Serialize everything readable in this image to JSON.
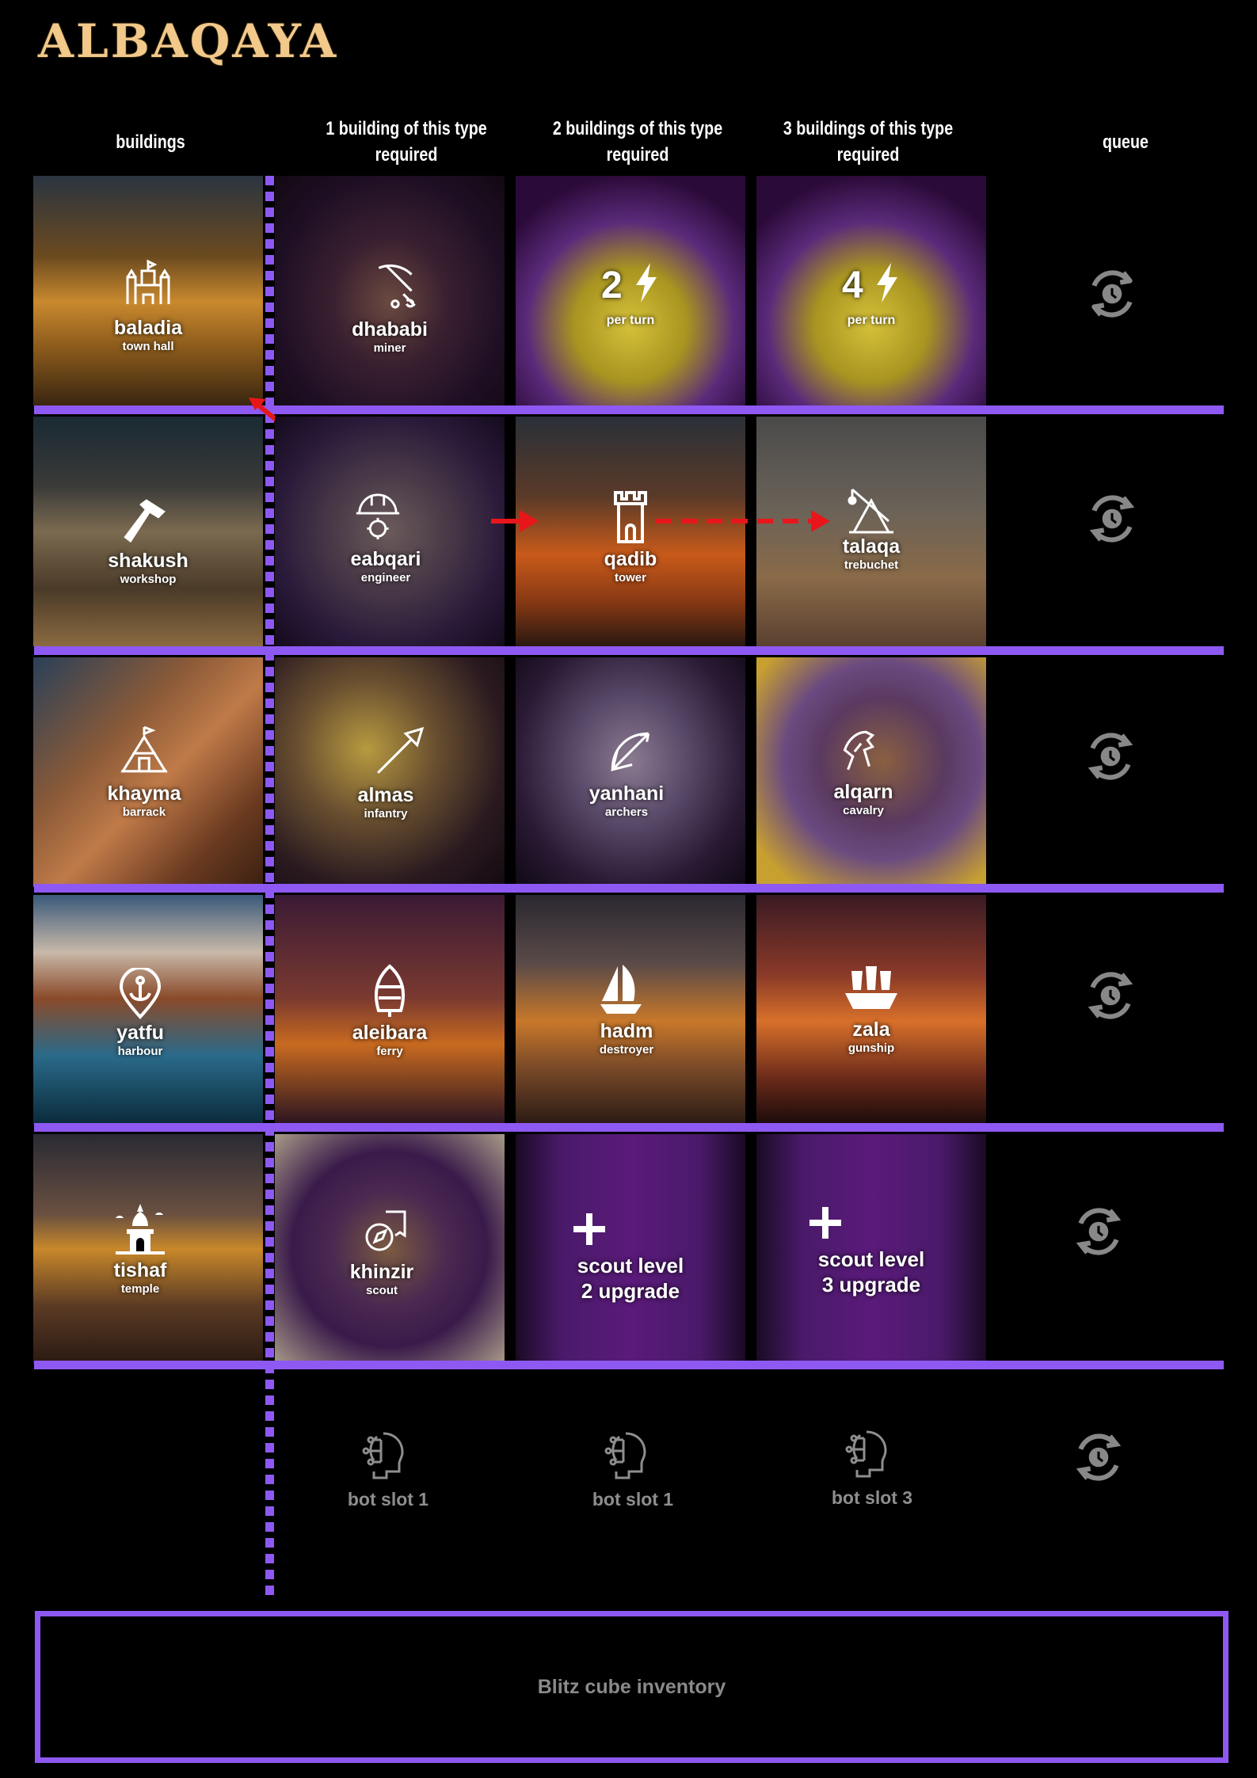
{
  "logo": "ALBAQAYA",
  "columns": {
    "buildings": "buildings",
    "req1": "1 building of this type required",
    "req2": "2 buildings of this type required",
    "req3": "3 buildings of this type required",
    "queue": "queue"
  },
  "rows": {
    "r1": {
      "building": {
        "name": "baladia",
        "sub": "town hall",
        "icon": "castle-icon"
      },
      "c1": {
        "name": "dhababi",
        "sub": "miner",
        "icon": "pickaxe-icon"
      },
      "c2": {
        "value": "2",
        "sub": "per turn",
        "icon": "lightning-icon"
      },
      "c3": {
        "value": "4",
        "sub": "per turn",
        "icon": "lightning-icon"
      }
    },
    "r2": {
      "building": {
        "name": "shakush",
        "sub": "workshop",
        "icon": "hammer-icon"
      },
      "c1": {
        "name": "eabqari",
        "sub": "engineer",
        "icon": "engineer-helmet-icon"
      },
      "c2": {
        "name": "qadib",
        "sub": "tower",
        "icon": "tower-icon"
      },
      "c3": {
        "name": "talaqa",
        "sub": "trebuchet",
        "icon": "trebuchet-icon"
      }
    },
    "r3": {
      "building": {
        "name": "khayma",
        "sub": "barrack",
        "icon": "tent-icon"
      },
      "c1": {
        "name": "almas",
        "sub": "infantry",
        "icon": "spear-icon"
      },
      "c2": {
        "name": "yanhani",
        "sub": "archers",
        "icon": "bow-icon"
      },
      "c3": {
        "name": "alqarn",
        "sub": "cavalry",
        "icon": "horse-icon"
      }
    },
    "r4": {
      "building": {
        "name": "yatfu",
        "sub": "harbour",
        "icon": "anchor-pin-icon"
      },
      "c1": {
        "name": "aleibara",
        "sub": "ferry",
        "icon": "boat-icon"
      },
      "c2": {
        "name": "hadm",
        "sub": "destroyer",
        "icon": "sailboat-icon"
      },
      "c3": {
        "name": "zala",
        "sub": "gunship",
        "icon": "galleon-icon"
      }
    },
    "r5": {
      "building": {
        "name": "tishaf",
        "sub": "temple",
        "icon": "temple-icon"
      },
      "c1": {
        "name": "khinzir",
        "sub": "scout",
        "icon": "compass-map-icon"
      },
      "c2": {
        "line1": "scout level",
        "line2": "2 upgrade",
        "icon": "plus-icon"
      },
      "c3": {
        "line1": "scout level",
        "line2": "3 upgrade",
        "icon": "plus-icon"
      }
    }
  },
  "bots": [
    "bot slot 1",
    "bot slot 1",
    "bot slot 3"
  ],
  "inventory": "Blitz cube inventory",
  "colors": {
    "accent": "#8e59f2",
    "arrow": "#e8161a",
    "logo": "#f2c98a"
  }
}
